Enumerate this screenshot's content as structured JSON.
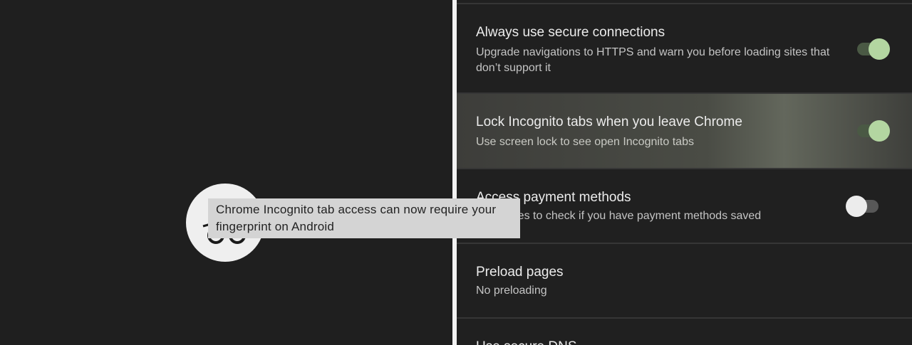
{
  "settings": [
    {
      "title": "Always use secure connections",
      "subtitle": "Upgrade navigations to HTTPS and warn you before loading sites that don’t support it",
      "toggle": "on"
    },
    {
      "title": "Lock Incognito tabs when you leave Chrome",
      "subtitle": "Use screen lock to see open Incognito tabs",
      "toggle": "on"
    },
    {
      "title": "Access payment methods",
      "subtitle": "Allow sites to check if you have payment methods saved",
      "toggle": "off"
    },
    {
      "title": "Preload pages",
      "subtitle": "No preloading"
    },
    {
      "title": "Use secure DNS"
    }
  ],
  "caption": {
    "text": "Chrome Incognito tab access can now require your fingerprint on Android"
  },
  "icon": {
    "name": "incognito-icon"
  },
  "colors": {
    "toggle_on_thumb": "#b3d6a1",
    "toggle_on_track": "#4a5944",
    "toggle_off_thumb": "#ececec",
    "background": "#1f1f1f"
  }
}
